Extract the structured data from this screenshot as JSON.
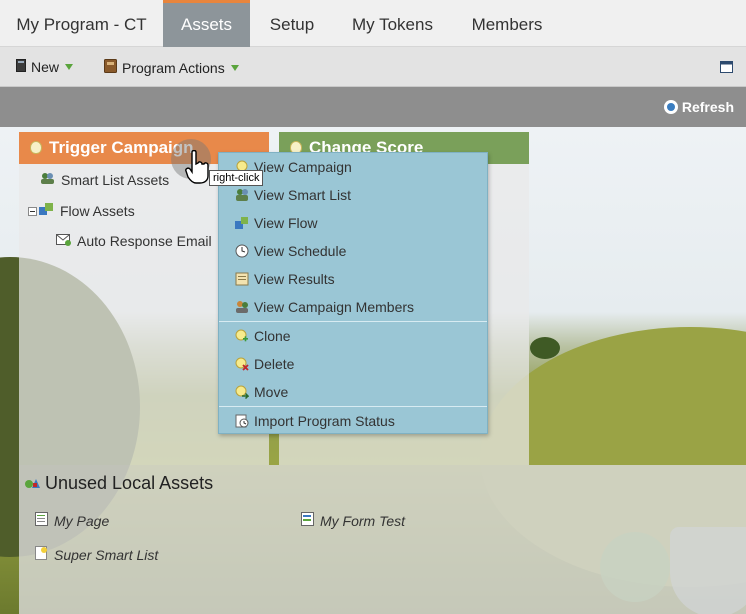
{
  "tabs": [
    {
      "label": "My Program - CT",
      "active": false
    },
    {
      "label": "Assets",
      "active": true
    },
    {
      "label": "Setup",
      "active": false
    },
    {
      "label": "My Tokens",
      "active": false
    },
    {
      "label": "Members",
      "active": false
    }
  ],
  "toolbar": {
    "new_label": "New",
    "program_actions_label": "Program Actions"
  },
  "strip": {
    "refresh_label": "Refresh"
  },
  "panels": {
    "trigger": {
      "title": "Trigger Campaign",
      "color": "#e8894a",
      "items": [
        "Smart List Assets",
        "Flow Assets",
        "Auto Response Email"
      ]
    },
    "change": {
      "title": "Change Score",
      "color": "#7aa05a"
    }
  },
  "tooltip": "right-click",
  "context_menu": {
    "items": [
      "View Campaign",
      "View Smart List",
      "View Flow",
      "View Schedule",
      "View Results",
      "View Campaign Members",
      "Clone",
      "Delete",
      "Move",
      "Import Program Status"
    ]
  },
  "unused": {
    "title": "Unused Local Assets",
    "assets": [
      "My Page",
      "My Form Test",
      "Super Smart List"
    ]
  }
}
